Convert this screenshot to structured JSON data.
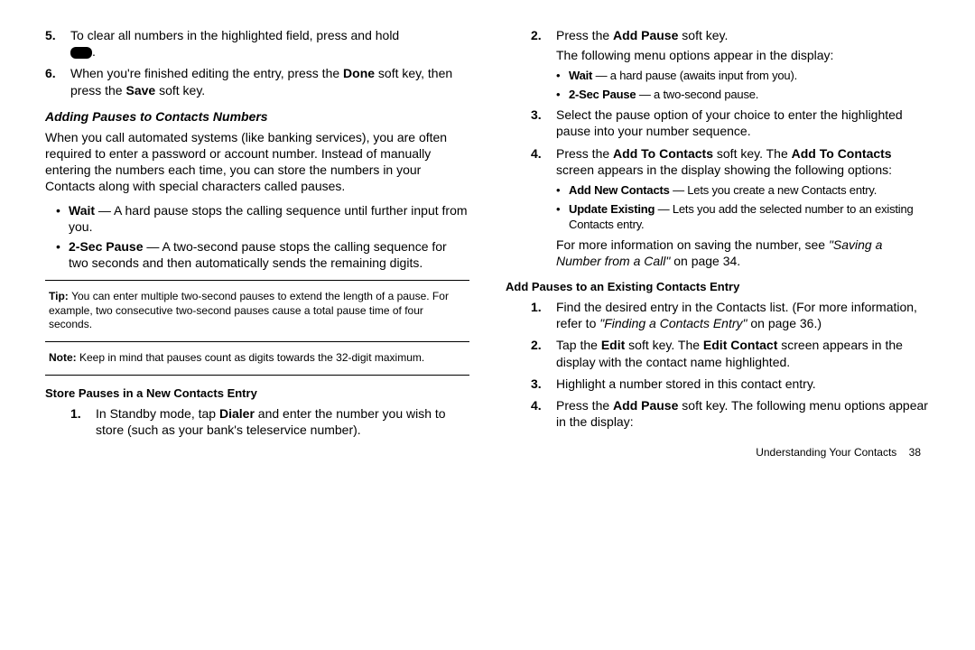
{
  "left": {
    "step5": "To clear all numbers in the highlighted field, press and hold",
    "step5_after": ".",
    "step6_a": "When you're finished editing the entry, press the ",
    "step6_b": "Done",
    "step6_c": " soft key, then press the ",
    "step6_d": "Save",
    "step6_e": " soft key.",
    "h1": "Adding Pauses to Contacts Numbers",
    "p1": "When you call automated systems (like banking services), you are often required to enter a password or account number. Instead of manually entering the numbers each time, you can store the numbers in your Contacts along with special characters called pauses.",
    "b1_lbl": "Wait",
    "b1_txt": " — A hard pause stops the calling sequence until further input from you.",
    "b2_lbl": "2-Sec Pause",
    "b2_txt": " — A two-second pause stops the calling sequence for two seconds and then automatically sends the remaining digits.",
    "tip_lbl": "Tip: ",
    "tip_txt": "You can enter multiple two-second pauses to extend the length of a pause. For example, two consecutive two-second pauses cause a total pause time of four seconds.",
    "note_lbl": "Note: ",
    "note_txt": "Keep in mind that pauses count as digits towards the 32-digit maximum.",
    "h2": "Store Pauses in a New Contacts Entry",
    "s1_a": "In Standby mode, tap ",
    "s1_b": "Dialer",
    "s1_c": " and enter the number you wish to store (such as your bank's teleservice number)."
  },
  "right": {
    "s2_a": "Press the ",
    "s2_b": "Add Pause",
    "s2_c": " soft key.",
    "s2_p2": "The following menu options appear in the display:",
    "b1_lbl": "Wait",
    "b1_txt": " — a hard pause (awaits input from you).",
    "b2_lbl": "2-Sec Pause",
    "b2_txt": " — a two-second pause.",
    "s3": "Select the pause option of your choice to enter the highlighted pause into your number sequence.",
    "s4_a": "Press the ",
    "s4_b": "Add To Contacts",
    "s4_c": " soft key. The ",
    "s4_d": "Add To Contacts",
    "s4_e": " screen appears in the display showing the following options:",
    "b3_lbl": "Add New Contacts",
    "b3_txt": " — Lets you create a new Contacts entry.",
    "b4_lbl": "Update Existing",
    "b4_txt": " — Lets you add the selected number to an existing Contacts entry.",
    "s4_p2_a": "For more information on saving the number, see ",
    "s4_p2_b": "\"Saving a Number from a Call\"",
    "s4_p2_c": " on page 34.",
    "h3": "Add Pauses to an Existing Contacts Entry",
    "e1_a": "Find the desired entry in the Contacts list. (For more information, refer to ",
    "e1_b": "\"Finding a Contacts Entry\"",
    "e1_c": "  on page 36.)",
    "e2_a": "Tap the ",
    "e2_b": "Edit",
    "e2_c": " soft key. The ",
    "e2_d": "Edit Contact",
    "e2_e": " screen appears in the display with the contact name highlighted.",
    "e3": "Highlight a number stored in this contact entry.",
    "e4_a": "Press the ",
    "e4_b": "Add Pause",
    "e4_c": " soft key. The following menu options appear in the display:"
  },
  "footer": {
    "section": "Understanding Your Contacts",
    "page": "38"
  }
}
